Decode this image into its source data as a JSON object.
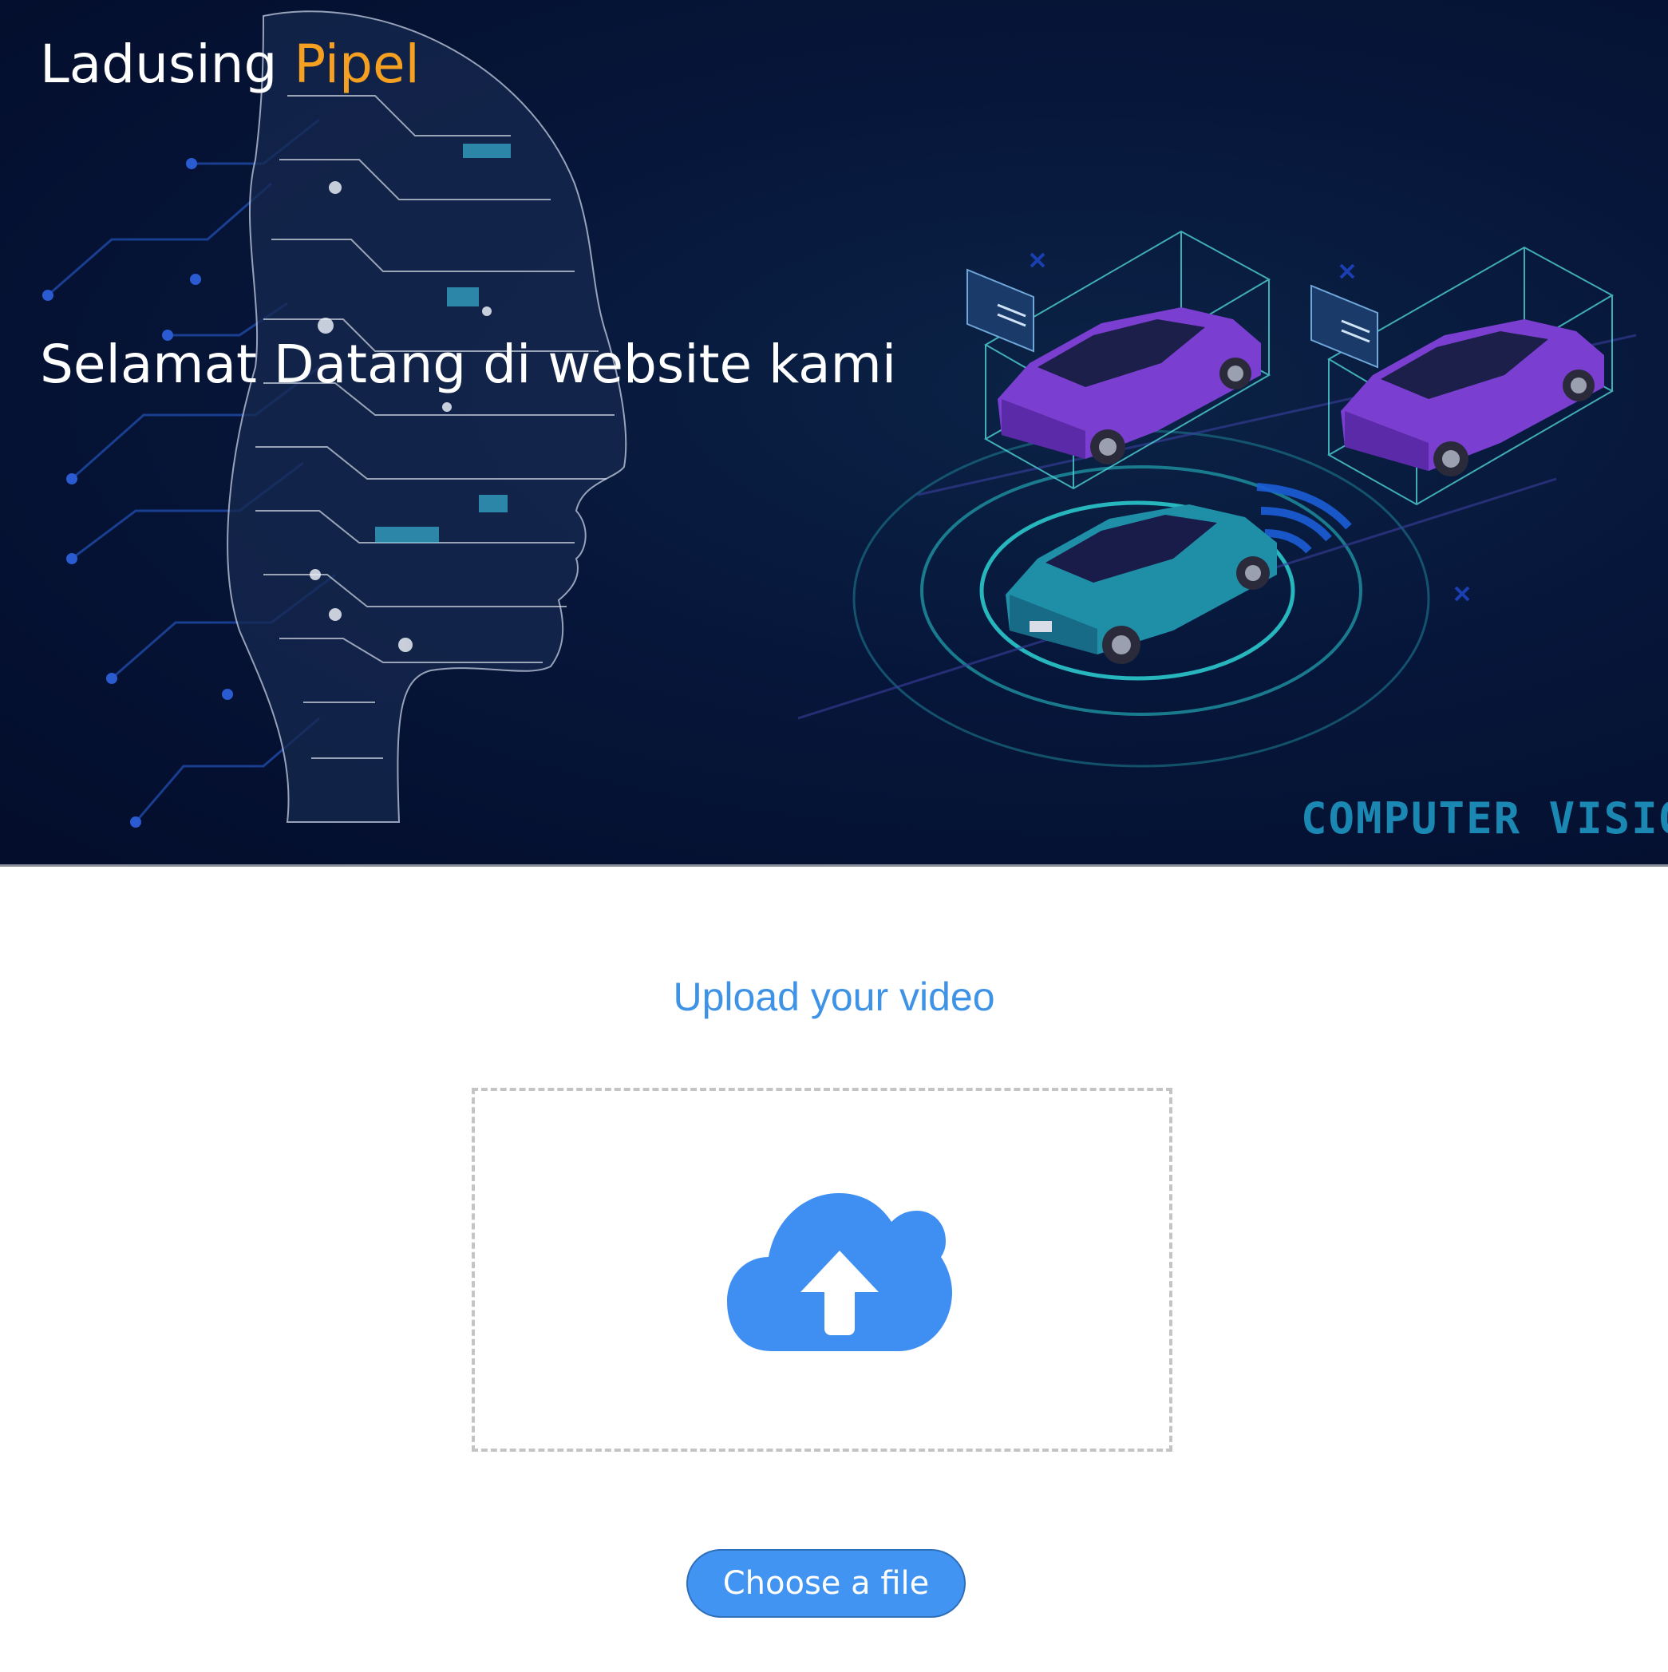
{
  "header": {
    "brand_primary": "Ladusing",
    "brand_accent": "Pipel",
    "welcome_text": "Selamat Datang di website kami",
    "hero_label": "COMPUTER VISION"
  },
  "upload": {
    "title": "Upload your video",
    "button_label": "Choose a file"
  },
  "colors": {
    "hero_background": "#06163a",
    "brand_accent": "#f5a021",
    "upload_blue": "#3f93e6",
    "button_blue": "#4294f2"
  },
  "icons": {
    "hero_illustration": "ai-head-and-autonomous-cars",
    "upload": "cloud-upload-icon"
  }
}
